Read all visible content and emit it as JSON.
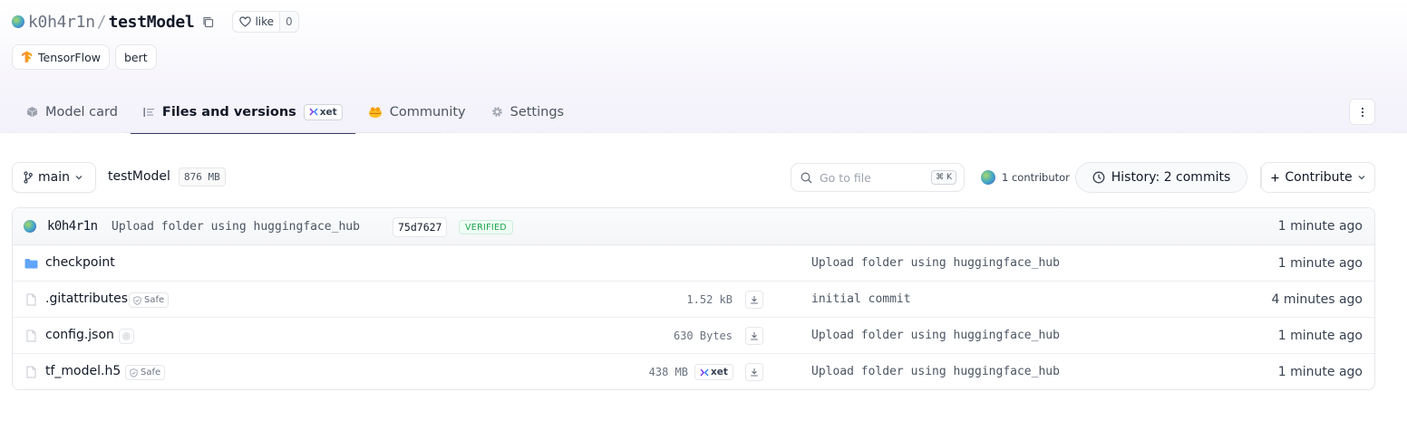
{
  "repo": {
    "owner": "k0h4r1n",
    "separator": "/",
    "name": "testModel",
    "like_label": "like",
    "like_count": "0"
  },
  "tags": [
    {
      "label": "TensorFlow",
      "icon": "tensorflow-icon"
    },
    {
      "label": "bert"
    }
  ],
  "tabs": [
    {
      "label": "Model card",
      "icon": "cube-icon",
      "active": false
    },
    {
      "label": "Files and versions",
      "icon": "files-icon",
      "badge": "xet",
      "active": true
    },
    {
      "label": "Community",
      "icon": "community-icon",
      "active": false
    },
    {
      "label": "Settings",
      "icon": "gear-icon",
      "active": false
    }
  ],
  "toolbar": {
    "branch": "main",
    "path": "testModel",
    "size": "876 MB",
    "search_placeholder": "Go to file",
    "search_shortcut": "⌘ K",
    "contributors": "1 contributor",
    "history": "History: 2 commits",
    "contribute": "Contribute"
  },
  "last_commit": {
    "author": "k0h4r1n",
    "message": "Upload folder using huggingface_hub",
    "sha": "75d7627",
    "verified": "VERIFIED",
    "time": "1 minute ago"
  },
  "files": [
    {
      "name": "checkpoint",
      "type": "folder",
      "commit": "Upload folder using huggingface_hub",
      "time": "1 minute ago"
    },
    {
      "name": ".gitattributes",
      "type": "file",
      "badge": "Safe",
      "size": "1.52 kB",
      "commit": "initial commit",
      "time": "4 minutes ago"
    },
    {
      "name": "config.json",
      "type": "file",
      "badge": "",
      "size": "630 Bytes",
      "commit": "Upload folder using huggingface_hub",
      "time": "1 minute ago"
    },
    {
      "name": "tf_model.h5",
      "type": "file",
      "badge": "Safe",
      "size": "438 MB",
      "xet": "xet",
      "commit": "Upload folder using huggingface_hub",
      "time": "1 minute ago"
    }
  ],
  "colors": {
    "accent": "#3b3f6b",
    "verified": "#16a34a",
    "folder": "#60a5fa",
    "tensorflow": "#f59e0b"
  }
}
